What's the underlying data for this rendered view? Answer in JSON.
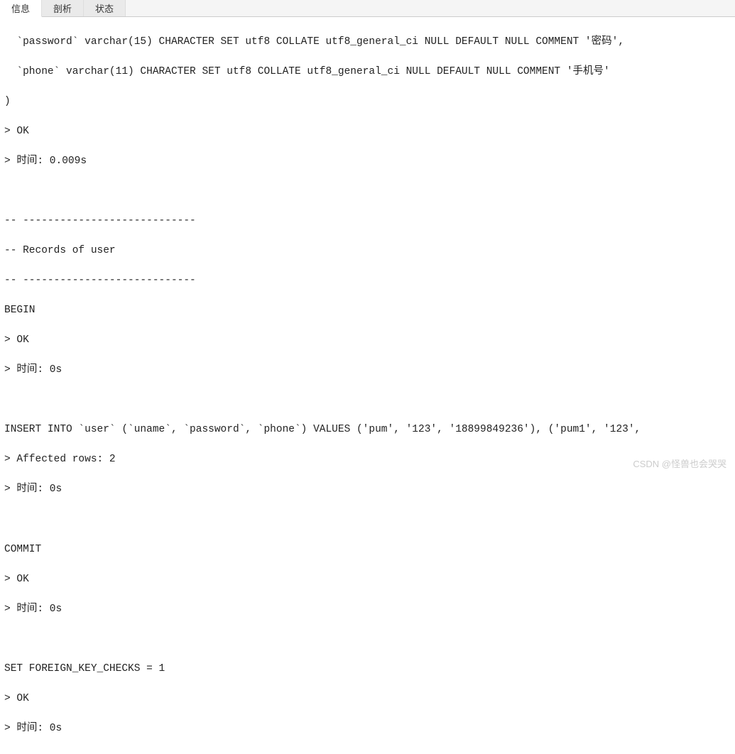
{
  "tabs": {
    "info": "信息",
    "profiling": "剖析",
    "status": "状态"
  },
  "log": {
    "line01": "  `password` varchar(15) CHARACTER SET utf8 COLLATE utf8_general_ci NULL DEFAULT NULL COMMENT '密码',",
    "line02": "  `phone` varchar(11) CHARACTER SET utf8 COLLATE utf8_general_ci NULL DEFAULT NULL COMMENT '手机号'",
    "line03": ")",
    "line04": "> OK",
    "line05": "> 时间: 0.009s",
    "line06": "",
    "line07": "",
    "line08": "-- ----------------------------",
    "line09": "-- Records of user",
    "line10": "-- ----------------------------",
    "line11": "BEGIN",
    "line12": "> OK",
    "line13": "> 时间: 0s",
    "line14": "",
    "line15": "",
    "line16": "INSERT INTO `user` (`uname`, `password`, `phone`) VALUES ('pum', '123', '18899849236'), ('pum1', '123',",
    "line17": "> Affected rows: 2",
    "line18": "> 时间: 0s",
    "line19": "",
    "line20": "",
    "line21": "COMMIT",
    "line22": "> OK",
    "line23": "> 时间: 0s",
    "line24": "",
    "line25": "",
    "line26": "SET FOREIGN_KEY_CHECKS = 1",
    "line27": "> OK",
    "line28": "> 时间: 0s"
  },
  "watermark": "CSDN @怪兽也会哭哭"
}
